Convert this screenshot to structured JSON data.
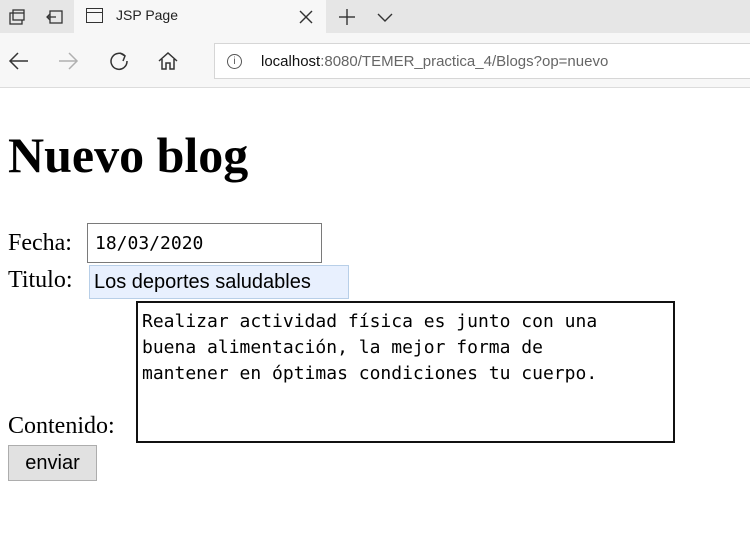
{
  "browser": {
    "tab": {
      "title": "JSP Page"
    },
    "url": {
      "host": "localhost",
      "rest": ":8080/TEMER_practica_4/Blogs?op=nuevo"
    },
    "icons": {
      "set_aside": "tabs-aside-icon",
      "restore": "tabs-restore-icon",
      "page": "page-icon",
      "close": "close-icon",
      "new_tab": "plus-icon",
      "tab_list": "chevron-down-icon",
      "back": "back-arrow-icon",
      "forward": "forward-arrow-icon",
      "refresh": "refresh-icon",
      "home": "home-icon",
      "info": "info-icon"
    }
  },
  "page": {
    "heading": "Nuevo blog",
    "form": {
      "fecha_label": "Fecha:",
      "fecha_value": "18/03/2020",
      "titulo_label": "Titulo:",
      "titulo_value": "Los deportes saludables",
      "contenido_label": "Contenido:",
      "contenido_value": "Realizar actividad física es junto con una\nbuena alimentación, la mejor forma de\nmantener en óptimas condiciones tu cuerpo.",
      "submit_label": "enviar"
    }
  },
  "colors": {
    "tabbar_bg": "#e6e6e6",
    "toolbar_bg": "#f7f7f7",
    "autofill_bg": "#e8f0fe"
  }
}
